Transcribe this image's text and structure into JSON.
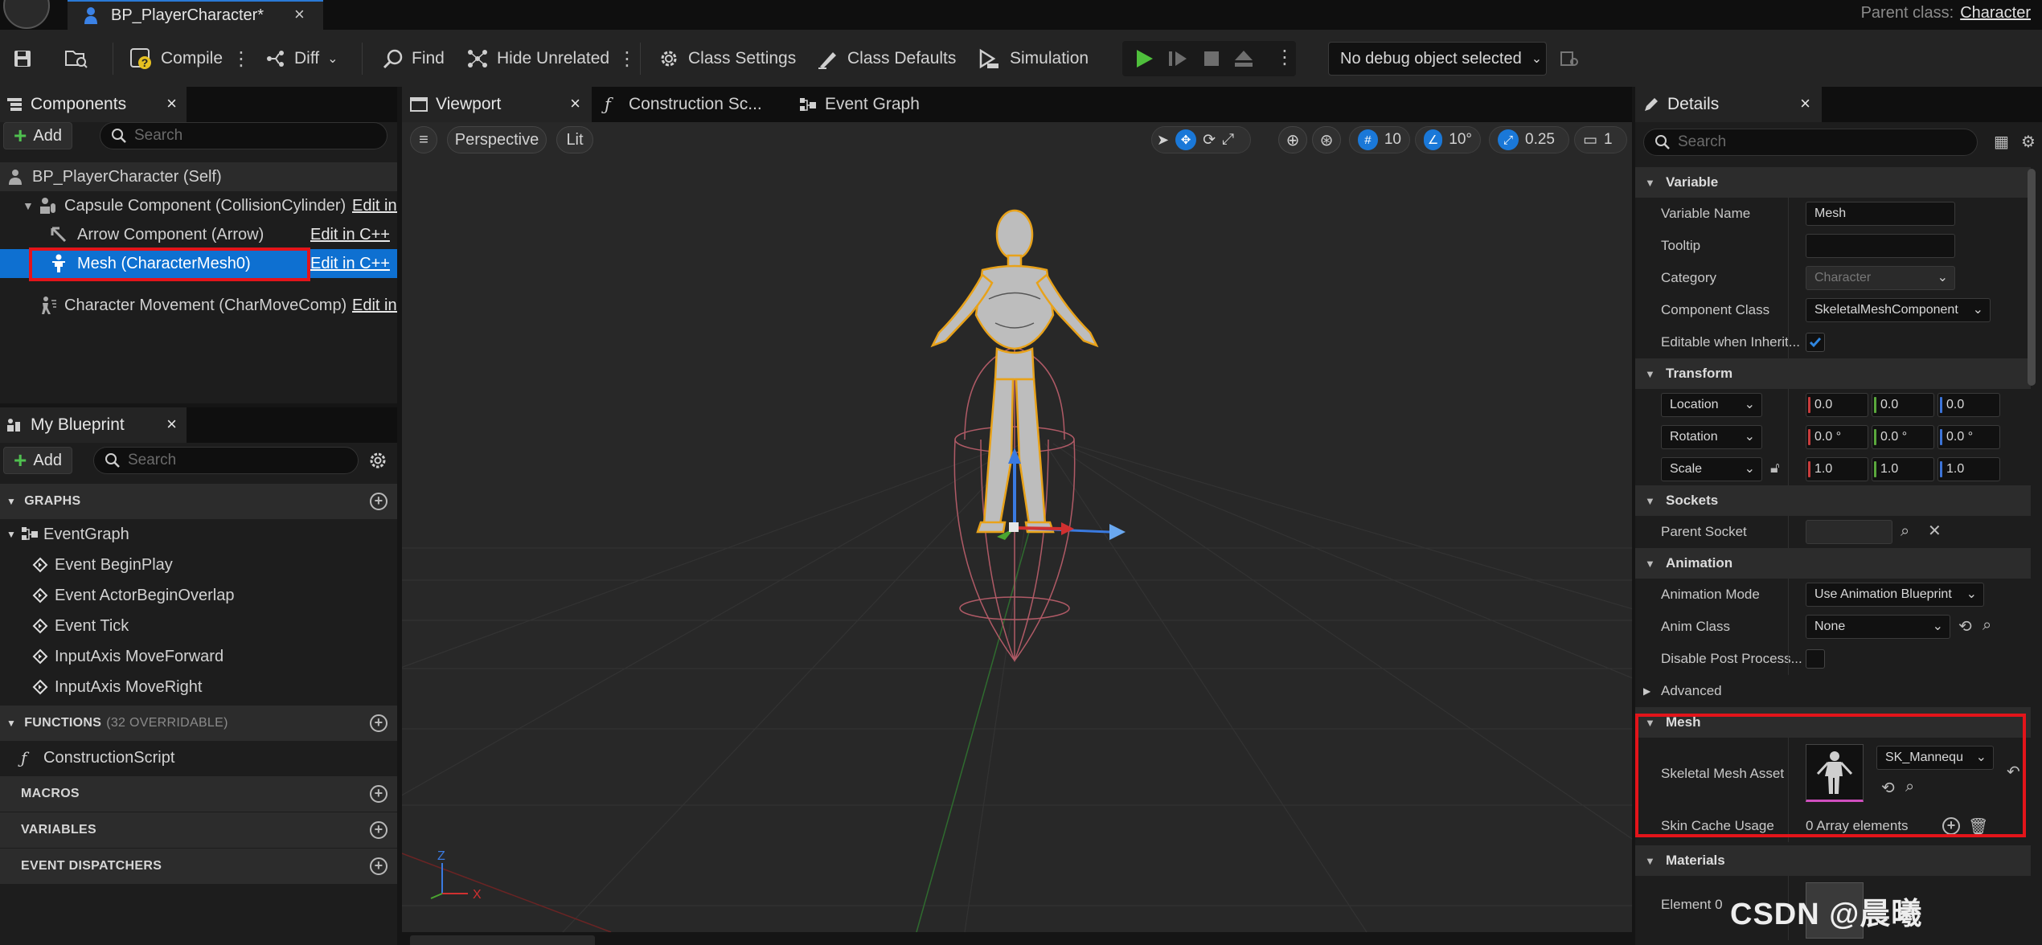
{
  "titlebar": {
    "doc_tab": "BP_PlayerCharacter*",
    "parent_class_label": "Parent class:",
    "parent_class_value": "Character"
  },
  "toolbar": {
    "compile": "Compile",
    "diff": "Diff",
    "find": "Find",
    "hide_unrelated": "Hide Unrelated",
    "class_settings": "Class Settings",
    "class_defaults": "Class Defaults",
    "simulation": "Simulation",
    "debug_select": "No debug object selected"
  },
  "components": {
    "tab": "Components",
    "add": "Add",
    "search_placeholder": "Search",
    "items": [
      {
        "label": "BP_PlayerCharacter (Self)",
        "edit": ""
      },
      {
        "label": "Capsule Component (CollisionCylinder)",
        "edit": "Edit in C++"
      },
      {
        "label": "Arrow Component (Arrow)",
        "edit": "Edit in C++"
      },
      {
        "label": "Mesh (CharacterMesh0)",
        "edit": "Edit in C++"
      },
      {
        "label": "Character Movement (CharMoveComp)",
        "edit": "Edit in C++"
      }
    ],
    "selected_index": 3
  },
  "my_blueprint": {
    "tab": "My Blueprint",
    "add": "Add",
    "search_placeholder": "Search",
    "graphs_header": "GRAPHS",
    "event_graph": "EventGraph",
    "events": [
      "Event BeginPlay",
      "Event ActorBeginOverlap",
      "Event Tick",
      "InputAxis MoveForward",
      "InputAxis MoveRight"
    ],
    "functions_header": "FUNCTIONS",
    "functions_sub": "(32 OVERRIDABLE)",
    "functions": [
      "ConstructionScript"
    ],
    "macros_header": "MACROS",
    "variables_header": "VARIABLES",
    "dispatchers_header": "EVENT DISPATCHERS"
  },
  "viewport": {
    "tabs": [
      "Viewport",
      "Construction Sc...",
      "Event Graph"
    ],
    "perspective": "Perspective",
    "lit": "Lit",
    "grid_snap": "10",
    "rot_snap": "10°",
    "scale_snap": "0.25",
    "camera_speed": "1",
    "axis_x": "X",
    "axis_z": "Z"
  },
  "details": {
    "tab": "Details",
    "search_placeholder": "Search",
    "sections": {
      "variable": "Variable",
      "transform": "Transform",
      "sockets": "Sockets",
      "animation": "Animation",
      "advanced": "Advanced",
      "mesh": "Mesh",
      "materials": "Materials"
    },
    "variable_name_label": "Variable Name",
    "variable_name_value": "Mesh",
    "tooltip_label": "Tooltip",
    "tooltip_value": "",
    "category_label": "Category",
    "category_value": "Character",
    "component_class_label": "Component Class",
    "component_class_value": "SkeletalMeshComponent",
    "editable_label": "Editable when Inherit...",
    "editable_checked": true,
    "location_label": "Location",
    "rotation_label": "Rotation",
    "scale_label": "Scale",
    "location": [
      "0.0",
      "0.0",
      "0.0"
    ],
    "rotation": [
      "0.0 °",
      "0.0 °",
      "0.0 °"
    ],
    "scale": [
      "1.0",
      "1.0",
      "1.0"
    ],
    "parent_socket_label": "Parent Socket",
    "animation_mode_label": "Animation Mode",
    "animation_mode_value": "Use Animation Blueprint",
    "anim_class_label": "Anim Class",
    "anim_class_value": "None",
    "disable_post_label": "Disable Post Process...",
    "skeletal_mesh_label": "Skeletal Mesh Asset",
    "skeletal_mesh_value": "SK_Mannequ",
    "skin_cache_label": "Skin Cache Usage",
    "skin_cache_value": "0 Array elements",
    "element0_label": "Element 0"
  },
  "watermark": "CSDN @晨曦"
}
